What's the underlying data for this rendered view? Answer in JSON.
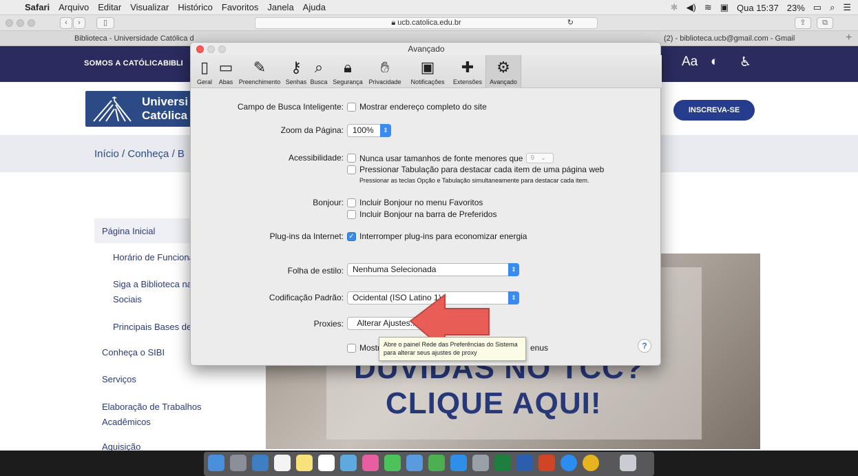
{
  "menubar": {
    "app": "Safari",
    "items": [
      "Arquivo",
      "Editar",
      "Visualizar",
      "Histórico",
      "Favoritos",
      "Janela",
      "Ajuda"
    ],
    "clock": "Qua 15:37",
    "battery": "23%"
  },
  "browser": {
    "url": "ucb.catolica.edu.br",
    "tabs": [
      "Biblioteca - Universidade Católica d",
      "(2) - biblioteca.ucb@gmail.com - Gmail"
    ]
  },
  "site": {
    "nav1": "SOMOS A CATÓLICA",
    "nav2": "BIBLI",
    "aa": "Aa",
    "logo_line1": "Universi",
    "logo_line2": "Católica",
    "inscreva": "INSCREVA-SE",
    "breadcrumb": "Início  /  Conheça  /  B",
    "sidebar": [
      "Página Inicial",
      "Horário de Funciona",
      "Siga a Biblioteca na",
      "Sociais",
      "Principais Bases de",
      "Conheça o SIBI",
      "Serviços",
      "Elaboração de Trabalhos",
      "Acadêmicos",
      "Aquisição"
    ],
    "banner_line1": "DÚVIDAS NO TCC?",
    "banner_line2": "CLIQUE AQUI!"
  },
  "prefs": {
    "title": "Avançado",
    "tabs": [
      "Geral",
      "Abas",
      "Preenchimento",
      "Senhas",
      "Busca",
      "Segurança",
      "Privacidade",
      "Notificações",
      "Extensões",
      "Avançado"
    ],
    "smart_search_label": "Campo de Busca Inteligente:",
    "smart_search_option": "Mostrar endereço completo do site",
    "zoom_label": "Zoom da Página:",
    "zoom_value": "100%",
    "access_label": "Acessibilidade:",
    "access_option1": "Nunca usar tamanhos de fonte menores que",
    "font_size": "9",
    "access_option2": "Pressionar Tabulação para destacar cada item de uma página web",
    "access_note": "Pressionar as teclas Opção e Tabulação simultaneamente para destacar cada item.",
    "bonjour_label": "Bonjour:",
    "bonjour_option1": "Incluir Bonjour no menu Favoritos",
    "bonjour_option2": "Incluir Bonjour na barra de Preferidos",
    "plugins_label": "Plug-ins da Internet:",
    "plugins_option": "Interromper plug-ins para economizar energia",
    "stylesheet_label": "Folha de estilo:",
    "stylesheet_value": "Nenhuma Selecionada",
    "encoding_label": "Codificação Padrão:",
    "encoding_value": "Ocidental (ISO Latino 1)",
    "proxies_label": "Proxies:",
    "proxies_button": "Alterar Ajustes...",
    "develop_option_start": "Mostr",
    "develop_option_end": "enus",
    "tooltip": "Abre o painel Rede das Preferências do Sistema para alterar seus ajustes de proxy",
    "help": "?"
  }
}
